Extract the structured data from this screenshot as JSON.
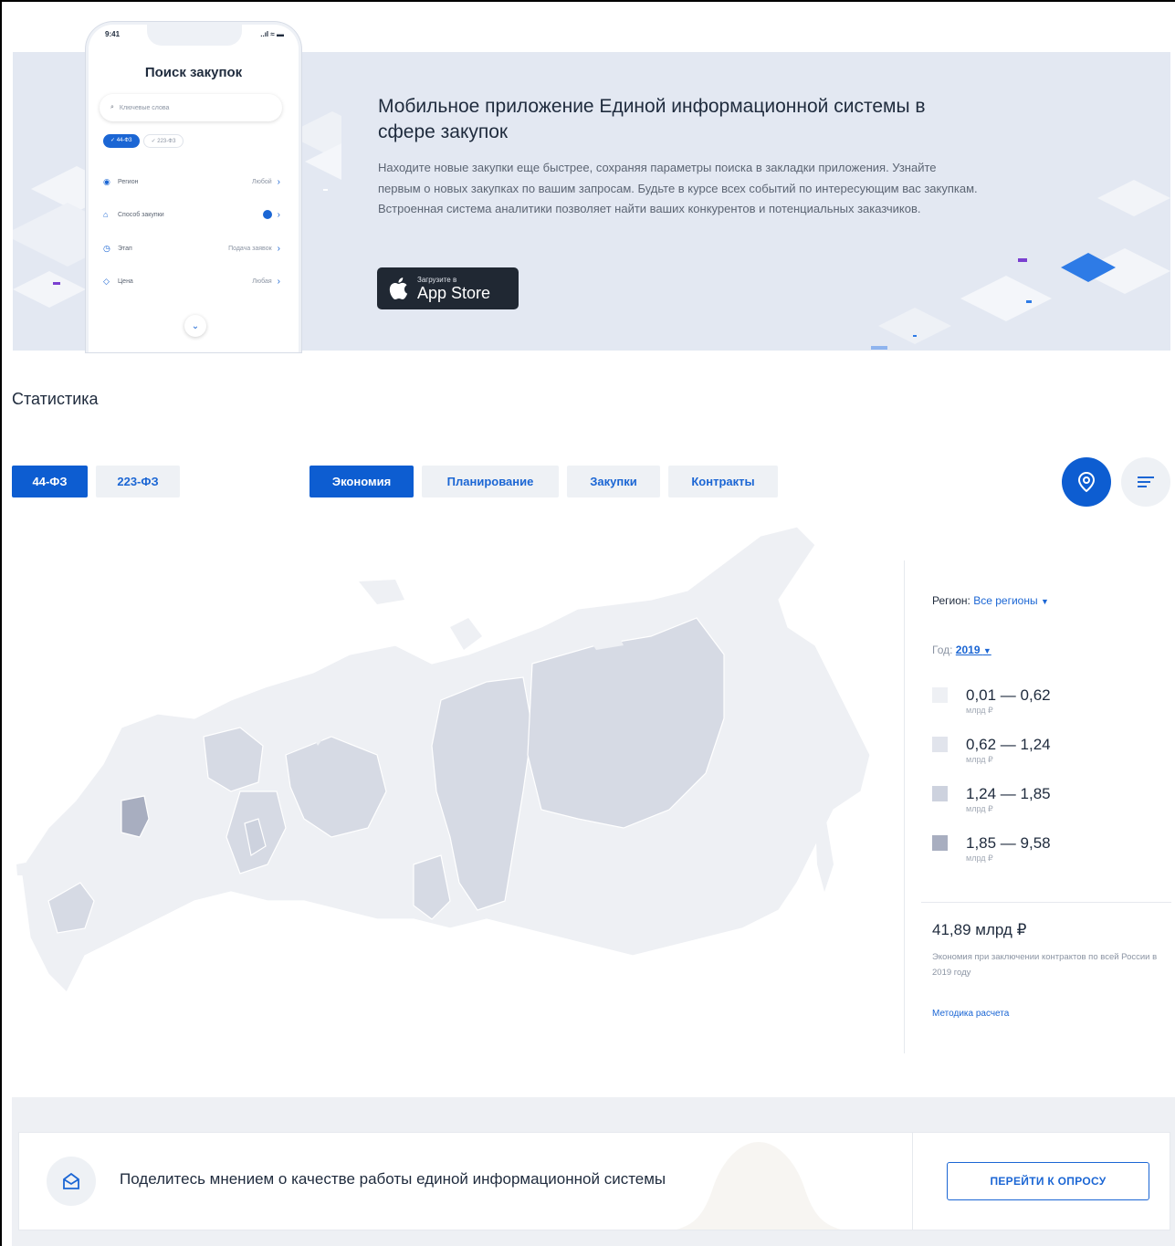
{
  "banner": {
    "title": "Мобильное приложение Единой информационной системы в сфере закупок",
    "text": "Находите новые закупки еще быстрее, сохраняя параметры поиска в закладки приложения. Узнайте первым о новых закупках по вашим запросам. Будьте в курсе всех событий по интересующим вас закупкам. Встроенная система аналитики позволяет найти ваших конкурентов и потенциальных заказчиков.",
    "appstore_small": "Загрузите в",
    "appstore_big": "App Store"
  },
  "phone": {
    "time": "9:41",
    "status": "..ıl ≈ ▬",
    "title": "Поиск закупок",
    "search_placeholder": "Ключевые слова",
    "chips": [
      "✓ 44-ФЗ",
      "✓ 223-ФЗ"
    ],
    "rows": [
      {
        "label": "Регион",
        "value": "Любой"
      },
      {
        "label": "Способ закупки",
        "value": ""
      },
      {
        "label": "Этап",
        "value": "Подача заявок"
      },
      {
        "label": "Цена",
        "value": "Любая"
      }
    ]
  },
  "stats": {
    "title": "Статистика",
    "law_tabs": [
      "44-ФЗ",
      "223-ФЗ"
    ],
    "category_tabs": [
      "Экономия",
      "Планирование",
      "Закупки",
      "Контракты"
    ]
  },
  "side": {
    "region_label": "Регион:",
    "region_value": "Все регионы",
    "year_label": "Год:",
    "year_value": "2019",
    "legend": [
      {
        "range": "0,01 — 0,62",
        "unit": "млрд ₽",
        "color": "#eef0f4"
      },
      {
        "range": "0,62 — 1,24",
        "unit": "млрд ₽",
        "color": "#e1e4ec"
      },
      {
        "range": "1,24 — 1,85",
        "unit": "млрд ₽",
        "color": "#cdd2de"
      },
      {
        "range": "1,85 — 9,58",
        "unit": "млрд ₽",
        "color": "#a8aec0"
      }
    ],
    "total": "41,89 млрд ₽",
    "note": "Экономия при заключении контрактов по всей России в 2019 году",
    "method": "Методика расчета"
  },
  "survey": {
    "text": "Поделитесь мнением о качестве работы единой информационной системы",
    "button": "ПЕРЕЙТИ К ОПРОСУ"
  },
  "colors": {
    "accent": "#0d5dd1",
    "banner_bg": "#e3e8f2"
  }
}
